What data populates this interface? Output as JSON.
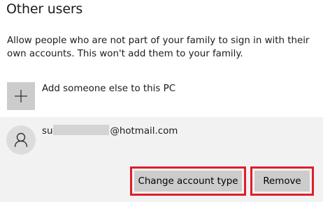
{
  "section": {
    "title": "Other users",
    "description": "Allow people who are not part of your family to sign in with their own accounts. This won't add them to your family."
  },
  "add_user": {
    "label": "Add someone else to this PC",
    "icon": "plus-icon"
  },
  "user_account": {
    "email_prefix": "su",
    "email_suffix": "@hotmail.com",
    "icon": "person-icon"
  },
  "actions": {
    "change_account_type_label": "Change account type",
    "remove_label": "Remove"
  },
  "colors": {
    "highlight": "#e01e2a",
    "button_bg": "#cccccc",
    "panel_bg": "#f2f2f2"
  }
}
